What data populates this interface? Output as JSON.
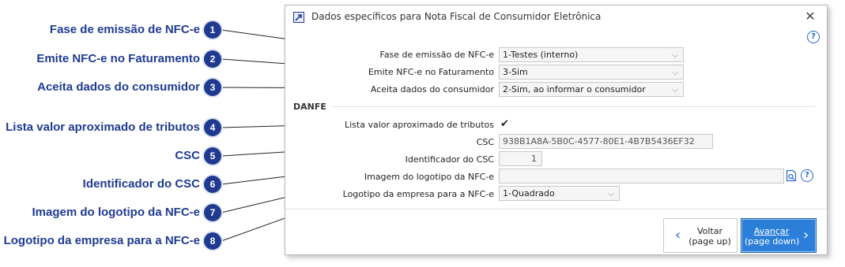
{
  "callouts": [
    {
      "number": "1",
      "label": "Fase de emissão de NFC-e"
    },
    {
      "number": "2",
      "label": "Emite NFC-e no Faturamento"
    },
    {
      "number": "3",
      "label": "Aceita dados do consumidor"
    },
    {
      "number": "4",
      "label": "Lista valor aproximado de tributos"
    },
    {
      "number": "5",
      "label": "CSC"
    },
    {
      "number": "6",
      "label": "Identificador do CSC"
    },
    {
      "number": "7",
      "label": "Imagem do logotipo da NFC-e"
    },
    {
      "number": "8",
      "label": "Logotipo da empresa para a NFC-e"
    }
  ],
  "dialog": {
    "title": "Dados específicos para Nota Fiscal de Consumidor Eletrônica",
    "close_glyph": "✕",
    "help_glyph": "?",
    "fields": {
      "fase_label": "Fase de emissão de NFC-e",
      "fase_value": "1-Testes (interno)",
      "emite_label": "Emite NFC-e no Faturamento",
      "emite_value": "3-Sim",
      "aceita_label": "Aceita dados do consumidor",
      "aceita_value": "2-Sim, ao informar o consumidor",
      "section_danfe": "DANFE",
      "lista_label": "Lista valor aproximado de tributos",
      "lista_checked": true,
      "lista_check_glyph": "✔",
      "csc_label": "CSC",
      "csc_value": "938B1A8A-5B0C-4577-80E1-4B7B5436EF32",
      "id_csc_label": "Identificador do CSC",
      "id_csc_value": "1",
      "imagem_label": "Imagem do logotipo da NFC-e",
      "imagem_value": "",
      "logotipo_label": "Logotipo da empresa para a NFC-e",
      "logotipo_value": "1-Quadrado"
    },
    "buttons": {
      "back_line1": "Voltar",
      "back_line2": "(page up)",
      "back_arrow": "‹",
      "next_line1": "Avançar",
      "next_line2": "(page down)",
      "next_arrow": "›"
    }
  },
  "colors": {
    "callout_text": "#1f3a93",
    "badge": "#1f3a8f",
    "primary_button": "#2b7fd8"
  }
}
